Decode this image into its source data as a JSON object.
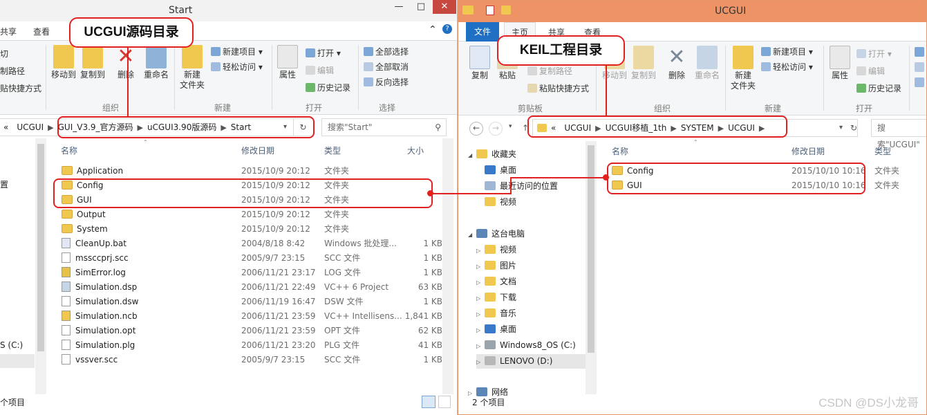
{
  "left_window": {
    "title": "Start",
    "window_buttons": [
      "—",
      "□",
      "✕"
    ],
    "tabs": [
      "共享",
      "查看"
    ],
    "ribbon": {
      "clip_items": [
        "切",
        "制路径",
        "贴快捷方式"
      ],
      "org_buttons": [
        "移动到",
        "复制到",
        "删除",
        "重命名"
      ],
      "new_button": [
        "新建",
        "文件夹"
      ],
      "new_items": [
        "新建项目 ▾",
        "轻松访问 ▾"
      ],
      "open_button": "属性",
      "open_items": [
        "打开 ▾",
        "编辑",
        "历史记录"
      ],
      "select_items": [
        "全部选择",
        "全部取消",
        "反向选择"
      ],
      "group_labels": [
        "组织",
        "新建",
        "打开",
        "选择"
      ]
    },
    "address": {
      "lead": "«",
      "crumbs": [
        "UCGUI",
        "GUI_V3.9_官方源码",
        "uCGUI3.90版源码",
        "Start"
      ],
      "search_placeholder": "搜索\"Start\""
    },
    "columns": [
      "名称",
      "修改日期",
      "类型",
      "大小"
    ],
    "files": [
      {
        "name": "Application",
        "date": "2015/10/9 20:12",
        "type": "文件夹",
        "size": "",
        "icon": "folder-icon"
      },
      {
        "name": "Config",
        "date": "2015/10/9 20:12",
        "type": "文件夹",
        "size": "",
        "icon": "folder-icon"
      },
      {
        "name": "GUI",
        "date": "2015/10/9 20:12",
        "type": "文件夹",
        "size": "",
        "icon": "folder-icon"
      },
      {
        "name": "Output",
        "date": "2015/10/9 20:12",
        "type": "文件夹",
        "size": "",
        "icon": "folder-icon"
      },
      {
        "name": "System",
        "date": "2015/10/9 20:12",
        "type": "文件夹",
        "size": "",
        "icon": "folder-icon"
      },
      {
        "name": "CleanUp.bat",
        "date": "2004/8/18 8:42",
        "type": "Windows 批处理...",
        "size": "1 KB",
        "icon": "bat-file-icon"
      },
      {
        "name": "mssccprj.scc",
        "date": "2005/9/7 23:15",
        "type": "SCC 文件",
        "size": "1 KB",
        "icon": "file-icon"
      },
      {
        "name": "SimError.log",
        "date": "2006/11/21 23:17",
        "type": "LOG 文件",
        "size": "1 KB",
        "icon": "log-file-icon"
      },
      {
        "name": "Simulation.dsp",
        "date": "2006/11/21 22:49",
        "type": "VC++ 6 Project",
        "size": "63 KB",
        "icon": "project-file-icon"
      },
      {
        "name": "Simulation.dsw",
        "date": "2006/11/19 16:47",
        "type": "DSW 文件",
        "size": "1 KB",
        "icon": "file-icon"
      },
      {
        "name": "Simulation.ncb",
        "date": "2006/11/21 23:59",
        "type": "VC++ Intellisens...",
        "size": "1,841 KB",
        "icon": "ncb-file-icon"
      },
      {
        "name": "Simulation.opt",
        "date": "2006/11/21 23:59",
        "type": "OPT 文件",
        "size": "62 KB",
        "icon": "file-icon"
      },
      {
        "name": "Simulation.plg",
        "date": "2006/11/21 23:20",
        "type": "PLG 文件",
        "size": "41 KB",
        "icon": "file-icon"
      },
      {
        "name": "vssver.scc",
        "date": "2005/9/7 23:15",
        "type": "SCC 文件",
        "size": "1 KB",
        "icon": "file-icon"
      }
    ],
    "nav_fragments": [
      "置",
      "S (C:)"
    ],
    "status": "个项目"
  },
  "right_window": {
    "title": "UCGUI",
    "tabs": [
      "文件",
      "主页",
      "共享",
      "查看"
    ],
    "ribbon": {
      "clip_buttons": [
        "复制",
        "粘贴"
      ],
      "clip_items": [
        "复制路径",
        "粘贴快捷方式"
      ],
      "org_buttons": [
        "移动到",
        "复制到",
        "删除",
        "重命名"
      ],
      "new_button": [
        "新建",
        "文件夹"
      ],
      "new_items": [
        "新建项目 ▾",
        "轻松访问 ▾"
      ],
      "open_button": "属性",
      "open_items": [
        "打开 ▾",
        "编辑",
        "历史记录"
      ],
      "group_labels": [
        "剪贴板",
        "组织",
        "新建",
        "打开"
      ]
    },
    "address": {
      "lead": "«",
      "crumbs": [
        "UCGUI",
        "UCGUI移植_1th",
        "SYSTEM",
        "UCGUI"
      ],
      "search_placeholder": "搜索\"UCGUI\""
    },
    "nav_tree": [
      {
        "label": "收藏夹",
        "arrow": "◢",
        "icon": "star-icon",
        "indent": 0
      },
      {
        "label": "桌面",
        "arrow": "",
        "icon": "desktop-icon",
        "indent": 1
      },
      {
        "label": "最近访问的位置",
        "arrow": "",
        "icon": "recent-icon",
        "indent": 1
      },
      {
        "label": "视频",
        "arrow": "",
        "icon": "video-folder-icon",
        "indent": 1
      },
      {
        "label": "这台电脑",
        "arrow": "◢",
        "icon": "computer-icon",
        "indent": 0
      },
      {
        "label": "视频",
        "arrow": "▷",
        "icon": "video-folder-icon",
        "indent": 1
      },
      {
        "label": "图片",
        "arrow": "▷",
        "icon": "picture-folder-icon",
        "indent": 1
      },
      {
        "label": "文档",
        "arrow": "▷",
        "icon": "document-folder-icon",
        "indent": 1
      },
      {
        "label": "下载",
        "arrow": "▷",
        "icon": "download-folder-icon",
        "indent": 1
      },
      {
        "label": "音乐",
        "arrow": "▷",
        "icon": "music-folder-icon",
        "indent": 1
      },
      {
        "label": "桌面",
        "arrow": "▷",
        "icon": "desktop-folder-icon",
        "indent": 1
      },
      {
        "label": "Windows8_OS (C:)",
        "arrow": "▷",
        "icon": "system-drive-icon",
        "indent": 1
      },
      {
        "label": "LENOVO (D:)",
        "arrow": "▷",
        "icon": "drive-icon",
        "indent": 1
      },
      {
        "label": "网络",
        "arrow": "▷",
        "icon": "network-icon",
        "indent": 0
      }
    ],
    "columns": [
      "名称",
      "修改日期",
      "类型"
    ],
    "files": [
      {
        "name": "Config",
        "date": "2015/10/10 10:16",
        "type": "文件夹"
      },
      {
        "name": "GUI",
        "date": "2015/10/10 10:16",
        "type": "文件夹"
      }
    ],
    "status": "2 个项目"
  },
  "annotations": {
    "left_label": "UCGUI源码目录",
    "right_label": "KEIL工程目录",
    "accent": "#e32020"
  },
  "watermark": "CSDN @DS小龙哥"
}
